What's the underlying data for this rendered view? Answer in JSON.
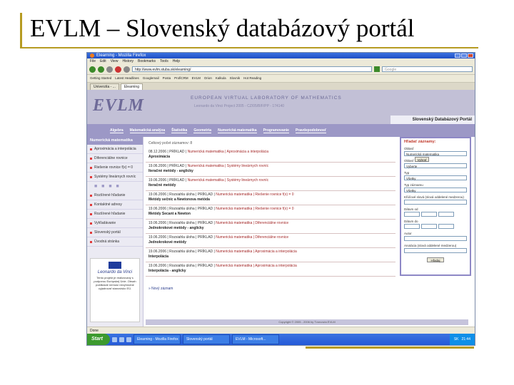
{
  "slide": {
    "title": "EVLM – Slovenský databázový portál"
  },
  "browser": {
    "window_title": "Elearning - Mozilla Firefox",
    "menu": [
      "File",
      "Edit",
      "View",
      "History",
      "Bookmarks",
      "Tools",
      "Help"
    ],
    "address": "http://www.evlm.stuba.sk/elearning/",
    "search_placeholder": "Google",
    "bookmarks": [
      "Getting Started",
      "Latest Headlines",
      "Googlemail",
      "Posta",
      "ProfiCRM",
      "EVLM",
      "Orion",
      "Kalkula",
      "Slovnik",
      "Hot Reading"
    ],
    "tabs": [
      {
        "label": "Univerzita - ..."
      },
      {
        "label": "Elearning"
      }
    ]
  },
  "site": {
    "logo": "EVLM",
    "project_title": "EUROPEAN VIRTUAL LABORATORY OF MATHEMATICS",
    "project_sub": "Leonardo da Vinci Project 2005 - CZ/05/B/F/PP - 174140",
    "portal_label": "Slovenský Databázový Portál",
    "categories": [
      "Algebra",
      "Matematická analýza",
      "Štatistika",
      "Geometria",
      "Numerická matematika",
      "Programovanie",
      "Pravdepodobnosť"
    ],
    "sidebar": {
      "header": "Numerická matematika",
      "items_top": [
        "Aproximácia a interpolácia",
        "Diferenciálne rovnice",
        "Riešenie rovnice f(x) = 0",
        "Systémy lineárnych rovníc"
      ],
      "dots": "■ ■ ■ ■",
      "items_bottom": [
        "Rozšírené hľadanie",
        "Kontaktné adresy",
        "Rozšírené hľadanie",
        "Vyhľadávanie",
        "Slovenský portál",
        "Úvodná stránka"
      ],
      "leonardo_name": "Leonardo da Vinci",
      "leonardo_text": "Tento projekt je realizovaný s podporou Európskej Únie. Obsah publikácie nemusí nevyhnutne vyjadrovať stanovisko EÚ."
    },
    "results": {
      "count": "Celkový počet záznamov: 8",
      "entries": [
        {
          "meta": "08.12.2006 | PRÍKLAD |",
          "source": "Numerická matematika | Aproximácia a interpolácia",
          "title": "Aproximácia"
        },
        {
          "meta": "19.06.2006 | PRÍKLAD |",
          "source": "Numerická matematika | Systémy lineárnych rovníc",
          "title": "Iteračné metódy - anglicky"
        },
        {
          "meta": "19.06.2006 | PRÍKLAD |",
          "source": "Numerická matematika | Systémy lineárnych rovníc",
          "title": "Iteračné metódy"
        },
        {
          "meta": "19.06.2006 | Rozsiahla úloha | PRÍKLAD |",
          "source": "Numerická matematika | Riešenie rovnice f(x) = 0",
          "title": "Metódy sečníc a Newtonova metóda"
        },
        {
          "meta": "19.06.2006 | Rozsiahla úloha | PRÍKLAD |",
          "source": "Numerická matematika | Riešenie rovnice f(x) = 0",
          "title": "Metódy Secant a Newton"
        },
        {
          "meta": "19.06.2006 | Rozsiahla úloha | PRÍKLAD |",
          "source": "Numerická matematika | Diferenciálne rovnice",
          "title": "Jednokrokové metódy - anglicky"
        },
        {
          "meta": "19.06.2006 | Rozsiahla úloha | PRÍKLAD |",
          "source": "Numerická matematika | Diferenciálne rovnice",
          "title": "Jednokrokové metódy"
        },
        {
          "meta": "19.06.2006 | Rozsiahla úloha | PRÍKLAD |",
          "source": "Numerická matematika | Aproximácia a interpolácia",
          "title": "Interpolácia"
        },
        {
          "meta": "19.06.2006 | Rozsiahla úloha | PRÍKLAD |",
          "source": "Numerická matematika | Aproximácia a interpolácia",
          "title": "Interpolácia - anglicky"
        }
      ],
      "new_link": "» Nový záznam"
    },
    "filter": {
      "header": "Hľadať záznamy:",
      "label_oblast": "Oblasť",
      "oblast_value": "Numerická matematika",
      "label_oblast2": "Oblasť",
      "oblast2_value": "Vyberte",
      "label_typ": "Typ",
      "typ_value": "Všetky",
      "label_typ_zaznamu": "Typ záznamu",
      "typ_zaznamu_value": "Všetky",
      "label_klucove": "Kľúčové slová (slová oddelené medzerou)",
      "label_datum_od": "Dátum od",
      "label_datum_do": "Dátum do",
      "label_autor": "Autor",
      "label_anotacia": "Anotácia (slová oddelené medzerou)",
      "search_button": "Hľadaj",
      "select_button": "Vybrať"
    },
    "footer": "Copyright © 2005 - 2006 by Tvorcovia EVLM"
  },
  "status": {
    "text": "Done"
  },
  "taskbar": {
    "start": "Start",
    "tasks": [
      "Elearning - Mozilla Firefox",
      "Slovenský portál",
      "EVLM - Microsoft..."
    ],
    "tray_lang": "SK",
    "tray_time": "21:44"
  }
}
